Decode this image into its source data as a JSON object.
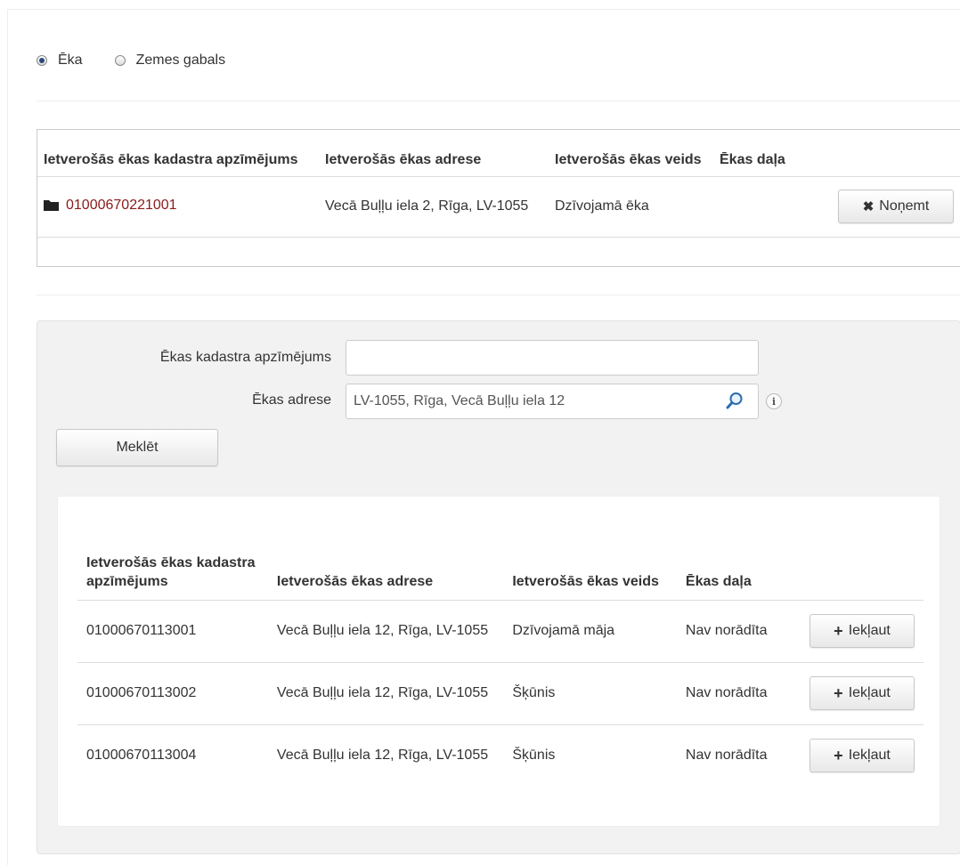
{
  "type_selector": {
    "options": [
      {
        "label": "Ēka",
        "checked": true
      },
      {
        "label": "Zemes gabals",
        "checked": false
      }
    ]
  },
  "selected_table": {
    "headers": [
      "Ietverošās ēkas kadastra apzīmējums",
      "Ietverošās ēkas adrese",
      "Ietverošās ēkas veids",
      "Ēkas daļa"
    ],
    "rows": [
      {
        "kadastrs": "01000670221001",
        "adrese": "Vecā Buļļu iela 2, Rīga, LV-1055",
        "veids": "Dzīvojamā ēka",
        "dala": "",
        "action": "Noņemt",
        "icon": "folder-icon"
      }
    ]
  },
  "search": {
    "kadastrs_label": "Ēkas kadastra apzīmējums",
    "kadastrs_value": "",
    "adrese_label": "Ēkas adrese",
    "adrese_value": "LV-1055, Rīga, Vecā Buļļu iela 12",
    "search_icon": "magnifier-icon",
    "info_icon": "info-icon",
    "search_button": "Meklēt"
  },
  "results_table": {
    "headers": [
      "Ietverošās ēkas kadastra apzīmējums",
      "Ietverošās ēkas adrese",
      "Ietverošās ēkas veids",
      "Ēkas daļa"
    ],
    "rows": [
      {
        "kadastrs": "01000670113001",
        "adrese": "Vecā Buļļu iela 12, Rīga, LV-1055",
        "veids": "Dzīvojamā māja",
        "dala": "Nav norādīta",
        "action": "Iekļaut"
      },
      {
        "kadastrs": "01000670113002",
        "adrese": "Vecā Buļļu iela 12, Rīga, LV-1055",
        "veids": "Šķūnis",
        "dala": "Nav norādīta",
        "action": "Iekļaut"
      },
      {
        "kadastrs": "01000670113004",
        "adrese": "Vecā Buļļu iela 12, Rīga, LV-1055",
        "veids": "Šķūnis",
        "dala": "Nav norādīta",
        "action": "Iekļaut"
      }
    ]
  },
  "colors": {
    "link": "#8b1a1a",
    "panel_bg": "#f2f2f2",
    "border": "#cccccc"
  }
}
